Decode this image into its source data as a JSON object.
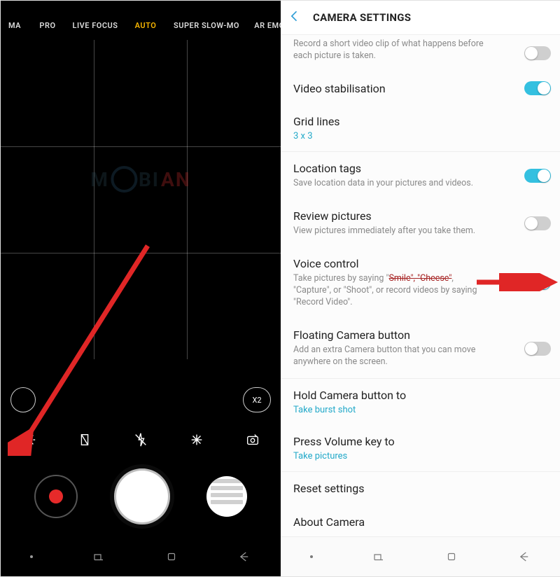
{
  "camera": {
    "modes": [
      "MA",
      "PRO",
      "LIVE FOCUS",
      "AUTO",
      "SUPER SLOW-MO",
      "AR EMO"
    ],
    "selected_mode": "AUTO",
    "zoom_label": "X2",
    "watermark_part1": "M",
    "watermark_part2": "BI",
    "watermark_part3": "AN"
  },
  "settings": {
    "title": "CAMERA SETTINGS",
    "items": [
      {
        "label": "",
        "sub": "Record a short video clip of what happens before each picture is taken.",
        "toggle": "off"
      },
      {
        "label": "Video stabilisation",
        "toggle": "on"
      },
      {
        "label": "Grid lines",
        "value": "3 x 3"
      },
      {
        "label": "Location tags",
        "sub": "Save location data in your pictures and videos.",
        "toggle": "on"
      },
      {
        "label": "Review pictures",
        "sub": "View pictures immediately after you take them.",
        "toggle": "off"
      },
      {
        "label": "Voice control",
        "sub_pre": "Take pictures by saying \"",
        "sub_strike": "Smile\", \"Cheese\"",
        "sub_post": ", \"Capture\", or \"Shoot\", or record videos by saying \"Record Video\".",
        "toggle": "on"
      },
      {
        "label": "Floating Camera button",
        "sub": "Add an extra Camera button that you can move anywhere on the screen.",
        "toggle": "off"
      },
      {
        "label": "Hold Camera button to",
        "value": "Take burst shot"
      },
      {
        "label": "Press Volume key to",
        "value": "Take pictures"
      },
      {
        "label": "Reset settings"
      },
      {
        "label": "About Camera"
      }
    ]
  },
  "annotations": {
    "arrow_color": "#e02626"
  }
}
